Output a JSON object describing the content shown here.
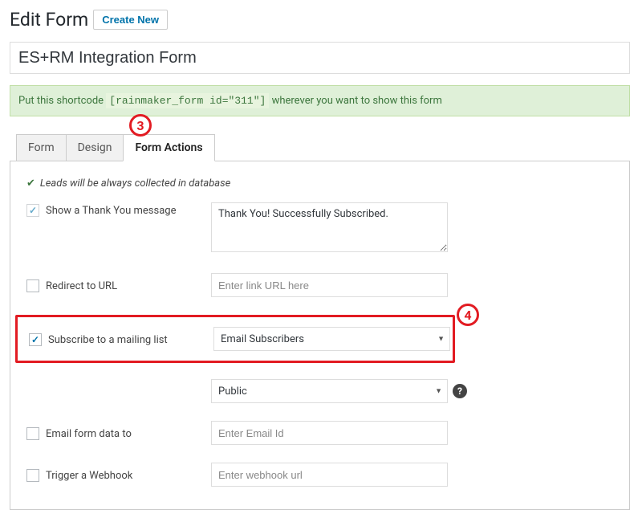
{
  "header": {
    "title": "Edit Form",
    "create_btn": "Create New"
  },
  "form_title": "ES+RM Integration Form",
  "shortcode": {
    "pre": "Put this shortcode ",
    "code": "[rainmaker_form id=\"311\"]",
    "post": " wherever you want to show this form"
  },
  "tabs": {
    "form": "Form",
    "design": "Design",
    "form_actions": "Form Actions"
  },
  "panel": {
    "info_line": "Leads will be always collected in database",
    "thank_you_label": "Show a Thank You message",
    "thank_you_value": "Thank You! Successfully Subscribed.",
    "redirect_label": "Redirect to URL",
    "redirect_placeholder": "Enter link URL here",
    "subscribe_label": "Subscribe to a mailing list",
    "subscribe_select": "Email Subscribers",
    "scope_select": "Public",
    "email_to_label": "Email form data to",
    "email_to_placeholder": "Enter Email Id",
    "webhook_label": "Trigger a Webhook",
    "webhook_placeholder": "Enter webhook url"
  },
  "annotations": {
    "three": "3",
    "four": "4"
  }
}
